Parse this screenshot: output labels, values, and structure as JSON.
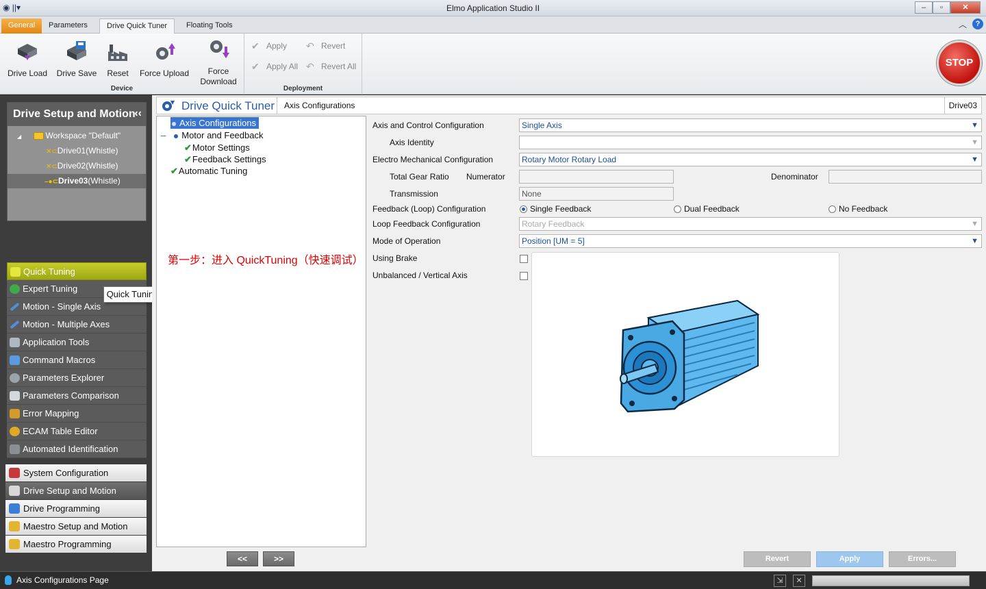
{
  "window": {
    "title": "Elmo Application Studio II"
  },
  "ribbon_tabs": [
    "General",
    "Parameters",
    "Drive Quick Tuner",
    "Floating Tools"
  ],
  "ribbon": {
    "device_group": "Device",
    "deployment_group": "Deployment",
    "device_buttons": [
      "Drive Load",
      "Drive Save",
      "Reset",
      "Force Upload",
      "Force\nDownload"
    ],
    "apply": "Apply",
    "apply_all": "Apply All",
    "revert": "Revert",
    "revert_all": "Revert All",
    "stop": "STOP"
  },
  "sidebar": {
    "header": "Drive Setup and Motion",
    "workspace": "Workspace \"Default\"",
    "drives": [
      {
        "name": "Drive01",
        "suffix": "(Whistle)"
      },
      {
        "name": "Drive02",
        "suffix": "(Whistle)"
      },
      {
        "name": "Drive03",
        "suffix": "(Whistle)"
      }
    ],
    "tools": [
      "Quick Tuning",
      "Expert Tuning",
      "Motion - Single Axis",
      "Motion - Multiple Axes",
      "Application Tools",
      "Command Macros",
      "Parameters Explorer",
      "Parameters Comparison",
      "Error Mapping",
      "ECAM Table Editor",
      "Automated Identification"
    ],
    "sections": [
      "System Configuration",
      "Drive Setup and Motion",
      "Drive Programming",
      "Maestro Setup and Motion",
      "Maestro Programming"
    ]
  },
  "tooltip": "Quick Tuning",
  "main": {
    "title": "Drive Quick Tuner",
    "breadcrumb": "Axis Configurations",
    "drive": "Drive03",
    "tree": {
      "axis_configurations": "Axis Configurations",
      "motor_and_feedback": "Motor and Feedback",
      "motor_settings": "Motor Settings",
      "feedback_settings": "Feedback Settings",
      "automatic_tuning": "Automatic Tuning"
    },
    "annotation": "第一步：进入 QuickTuning（快速调试）",
    "nav_prev": "<<",
    "nav_next": ">>",
    "form": {
      "axis_control_label": "Axis and Control Configuration",
      "axis_control_value": "Single Axis",
      "axis_identity_label": "Axis Identity",
      "axis_identity_value": "",
      "electro_mech_label": "Electro Mechanical Configuration",
      "electro_mech_value": "Rotary Motor Rotary Load",
      "total_gear_ratio_label": "Total Gear Ratio",
      "numerator_label": "Numerator",
      "numerator_value": "",
      "denominator_label": "Denominator",
      "denominator_value": "",
      "transmission_label": "Transmission",
      "transmission_value": "None",
      "feedback_loop_label": "Feedback (Loop) Configuration",
      "feedback_options": [
        "Single Feedback",
        "Dual Feedback",
        "No Feedback"
      ],
      "feedback_selected": "Single Feedback",
      "loop_feedback_label": "Loop Feedback Configuration",
      "loop_feedback_value": "Rotary Feedback",
      "mode_label": "Mode of Operation",
      "mode_value": "Position [UM = 5]",
      "brake_label": "Using Brake",
      "unbalanced_label": "Unbalanced / Vertical Axis"
    },
    "actions": {
      "revert": "Revert",
      "apply": "Apply",
      "errors": "Errors..."
    }
  },
  "statusbar": {
    "text": "Axis Configurations Page"
  }
}
